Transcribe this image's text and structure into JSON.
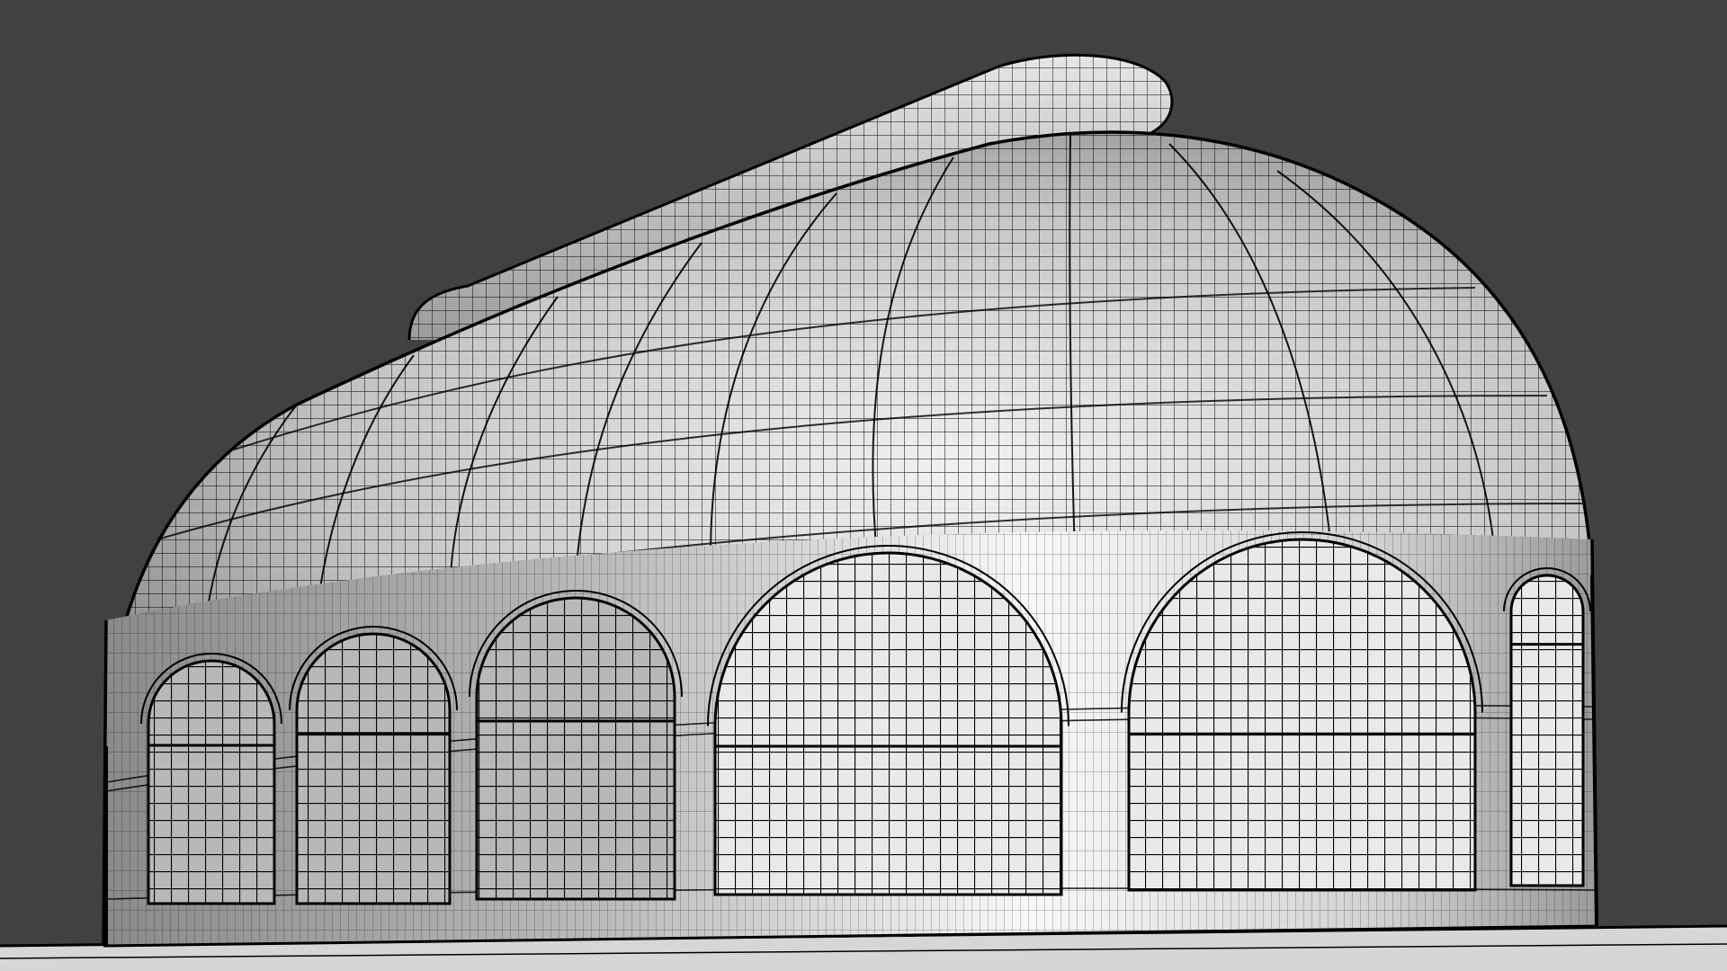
{
  "viewport": {
    "background_color": "#414141",
    "mesh_light_color": "#f7f7f7",
    "mesh_dark_color": "#8e8e8e",
    "wire_color": "#000000",
    "floor_color": "#d9d9d9"
  },
  "model": {
    "kind": "greenhouse-dome-wireframe",
    "icon": "wireframe-mesh-icon",
    "front_arch_count": 5,
    "side_arch_count": 4
  }
}
